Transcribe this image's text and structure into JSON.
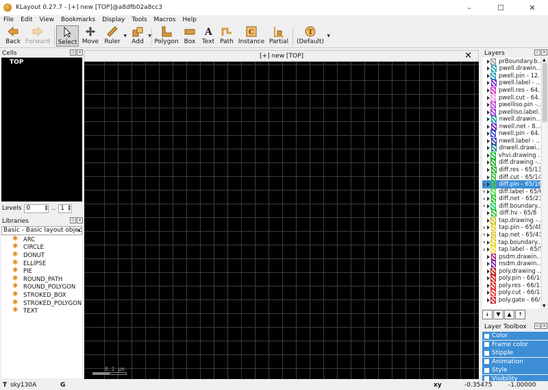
{
  "window": {
    "title": "KLayout 0.27.7 - [+] new [TOP]@a8dfb02a8cc3",
    "min": "–",
    "max": "☐",
    "close": "✕"
  },
  "menu": [
    "File",
    "Edit",
    "View",
    "Bookmarks",
    "Display",
    "Tools",
    "Macros",
    "Help"
  ],
  "toolbar": {
    "back": "Back",
    "forward": "Forward",
    "select": "Select",
    "move": "Move",
    "ruler": "Ruler",
    "add": "Add",
    "polygon": "Polygon",
    "box": "Box",
    "text": "Text",
    "path": "Path",
    "instance": "Instance",
    "partial": "Partial",
    "default": "(Default)"
  },
  "cells": {
    "title": "Cells",
    "items": [
      "TOP"
    ]
  },
  "levels": {
    "label": "Levels",
    "from": "0",
    "sep": "..",
    "to": "1"
  },
  "libraries": {
    "title": "Libraries",
    "selected": "Basic - Basic layout objects",
    "items": [
      "ARC",
      "CIRCLE",
      "DONUT",
      "ELLIPSE",
      "PIE",
      "ROUND_PATH",
      "ROUND_POLYGON",
      "STROKED_BOX",
      "STROKED_POLYGON",
      "TEXT"
    ]
  },
  "canvas": {
    "tab_title": "[+] new [TOP]",
    "close": "✕",
    "scale": "0.2 µm"
  },
  "layers": {
    "title": "Layers",
    "items": [
      {
        "name": "prBoundary.b...",
        "color": "#9a9a9a",
        "marks": ""
      },
      {
        "name": "pwell.drawin...",
        "color": "#2aa0b8",
        "marks": ""
      },
      {
        "name": "pwell.pin - 12...",
        "color": "#2aa0b8",
        "marks": ""
      },
      {
        "name": "pwell.label - ...",
        "color": "#7a2ad8",
        "marks": ""
      },
      {
        "name": "pwell.res - 64...",
        "color": "#d838c8",
        "marks": ""
      },
      {
        "name": "pwell.cut - 64...",
        "color": "#f0a0e0",
        "marks": ""
      },
      {
        "name": "pwelliso.pin -...",
        "color": "#c040d8",
        "marks": ""
      },
      {
        "name": "pwelliso.label...",
        "color": "#a030d0",
        "marks": ""
      },
      {
        "name": "nwell.drawin...",
        "color": "#20a0a0",
        "marks": ""
      },
      {
        "name": "nwell.net - 8...",
        "color": "#6020c0",
        "marks": ""
      },
      {
        "name": "nwell.pin - 64...",
        "color": "#3050d0",
        "marks": ""
      },
      {
        "name": "nwell.label - ...",
        "color": "#3040a8",
        "marks": ""
      },
      {
        "name": "dnwell.drawi...",
        "color": "#208090",
        "marks": ""
      },
      {
        "name": "vhvi.drawing ...",
        "color": "#20c040",
        "marks": ""
      },
      {
        "name": "diff.drawing -...",
        "color": "#20b020",
        "marks": ""
      },
      {
        "name": "diff.res - 65/13",
        "color": "#18a818",
        "marks": ""
      },
      {
        "name": "diff.cut - 65/14",
        "color": "#30c030",
        "marks": ""
      },
      {
        "name": "diff.pin - 65/16",
        "color": "#40d040",
        "marks": "x"
      },
      {
        "name": "diff.label - 65/6",
        "color": "#50e050",
        "marks": "x"
      },
      {
        "name": "diff.net - 65/23",
        "color": "#20c020",
        "marks": "x"
      },
      {
        "name": "diff.boundary...",
        "color": "#20d060",
        "marks": "x"
      },
      {
        "name": "diff.hv - 65/8",
        "color": "#40c040",
        "marks": ""
      },
      {
        "name": "tap.drawing -...",
        "color": "#d0c020",
        "marks": ""
      },
      {
        "name": "tap.pin - 65/48",
        "color": "#e0d030",
        "marks": "x"
      },
      {
        "name": "tap.net - 65/41",
        "color": "#d0c020",
        "marks": "x"
      },
      {
        "name": "tap.boundary....",
        "color": "#e0d020",
        "marks": "x"
      },
      {
        "name": "tap.label - 65/5",
        "color": "#f0e040",
        "marks": "x"
      },
      {
        "name": "psdm.drawin...",
        "color": "#a02080",
        "marks": ""
      },
      {
        "name": "nsdm.drawin...",
        "color": "#8020a0",
        "marks": ""
      },
      {
        "name": "poly.drawing ...",
        "color": "#c02020",
        "marks": ""
      },
      {
        "name": "poly.pin - 66/16",
        "color": "#d02020",
        "marks": ""
      },
      {
        "name": "poly.res - 66/13",
        "color": "#e03030",
        "marks": ""
      },
      {
        "name": "poly.cut - 66/14",
        "color": "#f04040",
        "marks": ""
      },
      {
        "name": "poly.gate - 66/9",
        "color": "#d02030",
        "marks": ""
      }
    ],
    "selected_index": 17
  },
  "layer_buttons": [
    "⯯",
    "▼",
    "▲",
    "⯭"
  ],
  "toolbox": {
    "title": "Layer Toolbox",
    "items": [
      "Color",
      "Frame color",
      "Stipple",
      "Animation",
      "Style",
      "Visibility"
    ]
  },
  "status": {
    "tech_mark": "T",
    "tech": "sky130A",
    "grid": "G",
    "xy_label": "xy",
    "x": "-0.35475",
    "y": "-1.00000"
  },
  "colors": {
    "selection": "#3d8ed6",
    "canvas": "#000000",
    "grid": "#3c3c3c"
  }
}
